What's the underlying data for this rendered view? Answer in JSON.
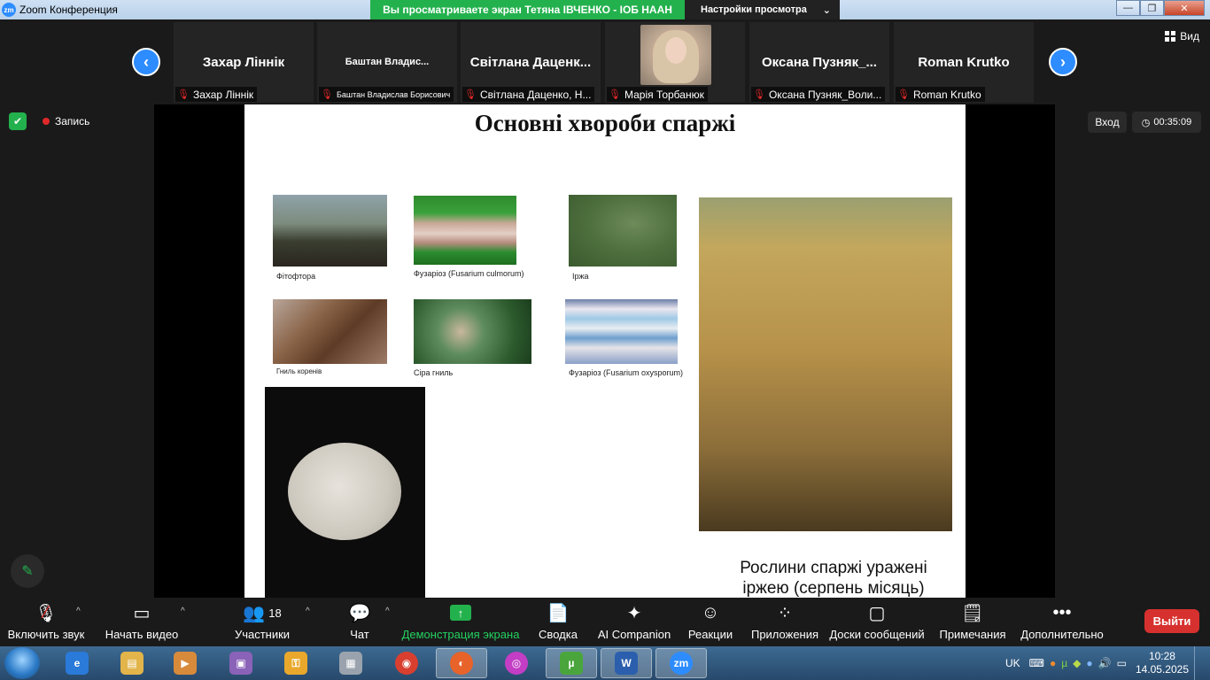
{
  "window": {
    "title": "Zoom Конференция",
    "logo_text": "zm"
  },
  "share_banner": {
    "viewing_text": "Вы просматриваете экран Тетяна ІВЧЕНКО - ІОБ НААН",
    "settings_label": "Настройки просмотра"
  },
  "gallery": {
    "prev_arrow": "‹",
    "next_arrow": "›",
    "view_label": "Вид",
    "tiles": [
      {
        "display": "Захар Ліннік",
        "label": "Захар Ліннік"
      },
      {
        "display": "Баштан  Владис...",
        "label": "Баштан Владислав Борисович"
      },
      {
        "display": "Світлана  Даценк...",
        "label": "Світлана Даценко, Н..."
      },
      {
        "display": "",
        "label": "Марія Торбанюк"
      },
      {
        "display": "Оксана  Пузняк_...",
        "label": "Оксана Пузняк_Воли..."
      },
      {
        "display": "Roman Krutko",
        "label": "Roman Krutko"
      }
    ]
  },
  "status": {
    "recording_label": "Запись",
    "exit_label": "Вход",
    "timer": "00:35:09"
  },
  "slide": {
    "title": "Основні хвороби  спаржі",
    "captions": {
      "phyto": "Фітофтора",
      "fus1": "Фузаріоз (Fusarium culmorum)",
      "rust": "Іржа",
      "root": "Гниль коренів",
      "gray": "Сіра гниль",
      "fus2": "Фузаріоз (Fusarium oxysporum)",
      "field_line1": "Рослини спаржі уражені",
      "field_line2": "іржею (серпень місяць)"
    }
  },
  "toolbar": {
    "audio": "Включить звук",
    "video": "Начать видео",
    "participants": "Участники",
    "participants_count": "18",
    "chat": "Чат",
    "share": "Демонстрация экрана",
    "summary": "Сводка",
    "ai": "AI Companion",
    "reactions": "Реакции",
    "apps": "Приложения",
    "boards": "Доски сообщений",
    "notes": "Примечания",
    "more": "Дополнительно",
    "leave": "Выйти"
  },
  "taskbar": {
    "lang": "UK",
    "time": "10:28",
    "date": "14.05.2025"
  },
  "colors": {
    "zoom_blue": "#2d8cff",
    "share_green": "#23b14d",
    "leave_red": "#d6312e"
  }
}
